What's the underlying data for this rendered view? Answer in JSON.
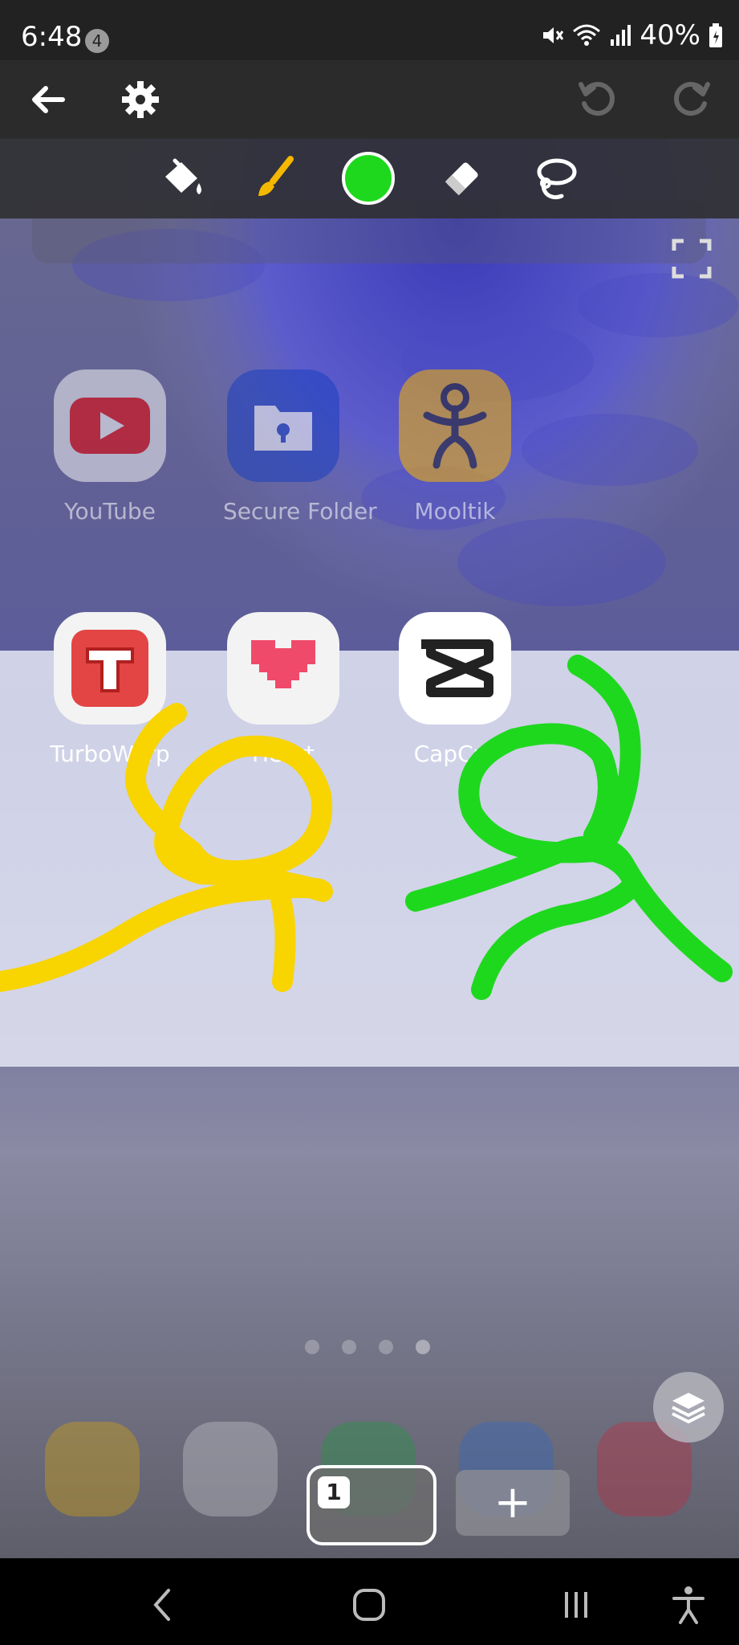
{
  "status_bar": {
    "time": "6:48",
    "notification_count": "4",
    "battery": "40%"
  },
  "top_bar": {
    "back_icon": "arrow-left-icon",
    "settings_icon": "gear-icon",
    "undo_icon": "undo-icon",
    "redo_icon": "redo-icon"
  },
  "toolbar": {
    "tools": [
      "paint-bucket-icon",
      "brush-icon",
      "color-swatch",
      "eraser-icon",
      "lasso-icon"
    ],
    "current_color": "#1ed81e",
    "brush_color": "#f5b800"
  },
  "apps": {
    "row1": [
      {
        "label": "YouTube"
      },
      {
        "label": "Secure Folder"
      },
      {
        "label": "Mooltik"
      }
    ],
    "row2": [
      {
        "label": "TurboWarp"
      },
      {
        "label": "Heart"
      },
      {
        "label": "CapCut"
      }
    ]
  },
  "strokes": {
    "yellow": "#f8d400",
    "green": "#1ed81e"
  },
  "frames": {
    "current_frame_number": "1",
    "add_label": "+"
  }
}
